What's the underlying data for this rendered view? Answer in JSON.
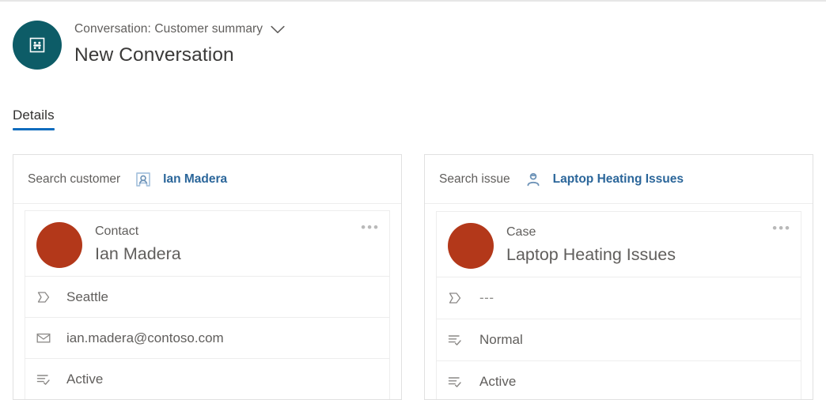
{
  "header": {
    "avatar_icon": "conversation-icon",
    "subtitle": "Conversation: Customer summary",
    "dropdown_icon": "chevron-down-icon",
    "title": "New Conversation",
    "avatar_color": "#0d5c67"
  },
  "tabs": [
    {
      "label": "Details",
      "active": true
    }
  ],
  "accent_color": "#0f6cbd",
  "link_color": "#2b669a",
  "avatar_record_color": "#b3381a",
  "cards": [
    {
      "search": {
        "label": "Search customer",
        "icon": "contact-card-icon",
        "value": "Ian Madera"
      },
      "record": {
        "type": "Contact",
        "name": "Ian Madera",
        "overflow_label": "•••",
        "fields": [
          {
            "icon": "tag-icon",
            "value": "Seattle",
            "muted": false
          },
          {
            "icon": "mail-icon",
            "value": "ian.madera@contoso.com",
            "muted": false
          },
          {
            "icon": "status-icon",
            "value": "Active",
            "muted": false
          }
        ]
      }
    },
    {
      "search": {
        "label": "Search issue",
        "icon": "case-person-icon",
        "value": "Laptop Heating Issues"
      },
      "record": {
        "type": "Case",
        "name": "Laptop Heating Issues",
        "overflow_label": "•••",
        "fields": [
          {
            "icon": "tag-icon",
            "value": "---",
            "muted": true
          },
          {
            "icon": "status-icon",
            "value": "Normal",
            "muted": false
          },
          {
            "icon": "status-icon",
            "value": "Active",
            "muted": false
          }
        ]
      }
    }
  ]
}
